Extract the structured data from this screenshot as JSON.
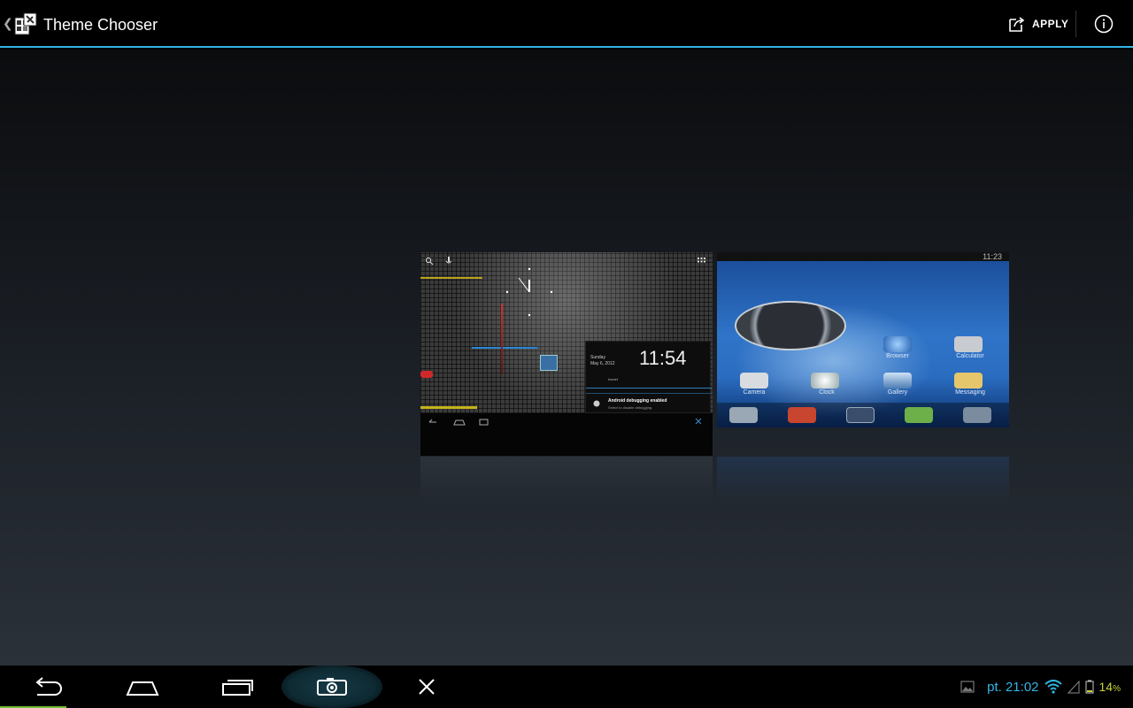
{
  "action_bar": {
    "up_caret": "❮",
    "app_icon": "theme-chooser-app-icon",
    "title": "Theme Chooser",
    "apply_label": "APPLY",
    "apply_icon": "share-edit-icon",
    "info_icon": "info-icon",
    "accent_color": "#33b5e5"
  },
  "previews": [
    {
      "name": "ics-carbon-theme",
      "notification": {
        "day": "Sunday",
        "date": "May 6, 2012",
        "time": "11:54",
        "carrier": "Iconet",
        "title": "Android debugging enabled",
        "subtitle": "Select to disable debugging."
      }
    },
    {
      "name": "samsung-blue-theme",
      "status_time": "11:23",
      "apps": [
        "Browser",
        "Calculator",
        "Camera",
        "Clock",
        "Gallery",
        "Messaging"
      ]
    }
  ],
  "nav_bar": {
    "back_icon": "back-arrow-icon",
    "home_icon": "home-icon",
    "recents_icon": "recent-apps-icon",
    "screenshot_icon": "camera-icon",
    "close_icon": "close-icon"
  },
  "system_tray": {
    "notification_icon": "image-icon",
    "time": "pt. 21:02",
    "wifi_icon": "wifi-icon",
    "signal_icon": "signal-icon",
    "battery_icon": "battery-icon",
    "battery_percent": "14",
    "battery_unit": "%"
  }
}
